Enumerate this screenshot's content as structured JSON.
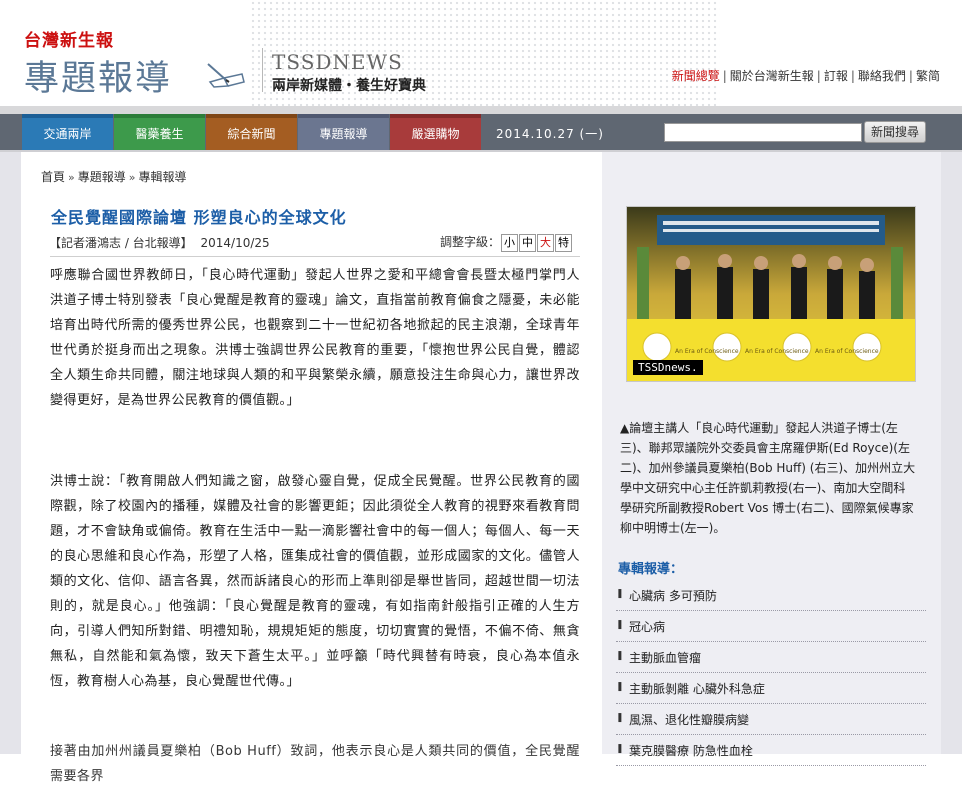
{
  "header": {
    "paper_logo": "台灣新生報",
    "section_logo": "專題報導",
    "tss_title": "TSSDNEWS",
    "tss_slogan": "兩岸新媒體・養生好寶典",
    "top_links": [
      "新聞總覽",
      "關於台灣新生報",
      "訂報",
      "聯絡我們",
      "繁",
      "简"
    ]
  },
  "nav": {
    "tabs": [
      {
        "label": "交通兩岸",
        "color": "#2b7ab6",
        "cap": "#1c5f96"
      },
      {
        "label": "醫藥養生",
        "color": "#3d9a4b",
        "cap": "#2c7d39"
      },
      {
        "label": "綜合新聞",
        "color": "#a45d22",
        "cap": "#7f4616"
      },
      {
        "label": "專題報導",
        "color": "#6b7690",
        "cap": "#4f5870"
      },
      {
        "label": "嚴選購物",
        "color": "#a83b3b",
        "cap": "#842a2a"
      }
    ],
    "date": "2014.10.27 (一)",
    "search_placeholder": "",
    "search_button": "新聞搜尋"
  },
  "breadcrumb": [
    "首頁",
    "專題報導",
    "專輯報導"
  ],
  "article": {
    "title": "全民覺醒國際論壇 形塑良心的全球文化",
    "byline": "【記者潘鴻志 / 台北報導】",
    "date": "2014/10/25",
    "font_size_label": "調整字級：",
    "font_sizes": [
      "小",
      "中",
      "大",
      "特"
    ],
    "paragraphs": [
      "呼應聯合國世界教師日，「良心時代運動」發起人世界之愛和平總會會長暨太極門掌門人洪道子博士特別發表「良心覺醒是教育的靈魂」論文，直指當前教育偏食之隱憂，未必能培育出時代所需的優秀世界公民，也觀察到二十一世紀初各地掀起的民主浪潮，全球青年世代勇於挺身而出之現象。洪博士強調世界公民教育的重要，「懷抱世界公民自覺，體認全人類生命共同體，關注地球與人類的和平與繁榮永續，願意投注生命與心力，讓世界改變得更好，是為世界公民教育的價值觀。」",
      "洪博士說：「教育開啟人們知識之窗，啟發心靈自覺，促成全民覺醒。世界公民教育的國際觀，除了校園內的播種，媒體及社會的影響更鉅；因此須從全人教育的視野來看教育問題，才不會缺角或偏倚。教育在生活中一點一滴影響社會中的每一個人；每個人、每一天的良心思維和良心作為，形塑了人格，匯集成社會的價值觀，並形成國家的文化。儘管人類的文化、信仰、語言各異，然而訴諸良心的形而上準則卻是舉世皆同，超越世間一切法則的，就是良心。」他強調：「良心覺醒是教育的靈魂，有如指南針般指引正確的人生方向，引導人們知所對錯、明禮知恥，規規矩矩的態度，切切實實的覺悟，不偏不倚、無貪無私，自然能和氣為懷，致天下蒼生太平。」並呼籲「時代興替有時衰，良心為本值永恆，教育樹人心為基，良心覺醒世代傳。」",
      "接著由加州州議員夏樂柏（Bob Huff）致詞，他表示良心是人類共同的價值，全民覺醒需要各界"
    ]
  },
  "sidebar": {
    "photo_watermark": "TSSDnews.",
    "photo_banner": "An Era of Conscience",
    "caption": "▲論壇主講人「良心時代運動」發起人洪道子博士(左三)、聯邦眾議院外交委員會主席羅伊斯(Ed Royce)(左二)、加州參議員夏樂柏(Bob Huff) (右三)、加州州立大學中文研究中心主任許凱莉教授(右一)、南加大空間科學研究所副教授Robert Vos 博士(右二)、國際氣候專家柳中明博士(左一)。",
    "related_title": "專輯報導：",
    "related": [
      "心臟病 多可預防",
      "冠心病",
      "主動脈血管瘤",
      "主動脈剝離 心臟外科急症",
      "風濕、退化性瓣膜病變",
      "葉克膜醫療 防急性血栓"
    ]
  }
}
